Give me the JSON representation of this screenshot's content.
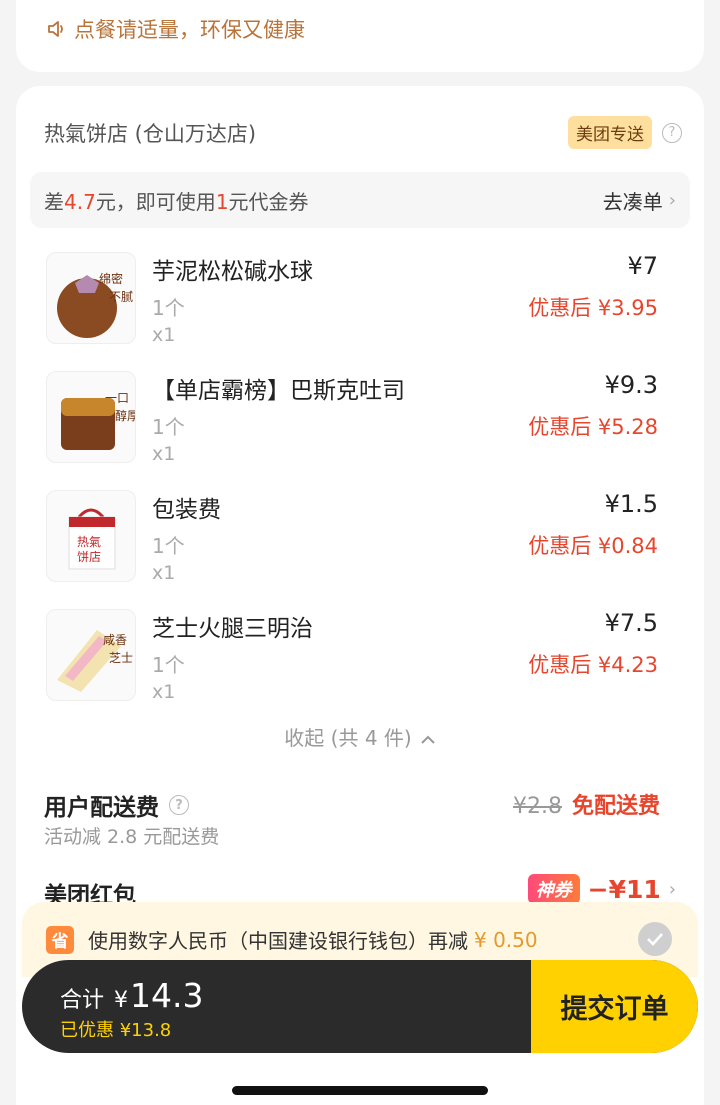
{
  "notice": {
    "text": "点餐请适量，环保又健康"
  },
  "store": {
    "name": "热氣饼店 (仓山万达店)",
    "delivery_badge": "美团专送",
    "help": "?"
  },
  "coupon_bar": {
    "prefix": "差",
    "amount": "4.7",
    "middle": "元，即可使用",
    "coupon_value": "1",
    "suffix": "元代金券",
    "action": "去凑单"
  },
  "items": [
    {
      "name": "芋泥松松碱水球",
      "qty": "1个",
      "count": "x1",
      "price": "¥7",
      "discount": "优惠后 ¥3.95"
    },
    {
      "name": "【单店霸榜】巴斯克吐司",
      "qty": "1个",
      "count": "x1",
      "price": "¥9.3",
      "discount": "优惠后 ¥5.28"
    },
    {
      "name": "包装费",
      "qty": "1个",
      "count": "x1",
      "price": "¥1.5",
      "discount": "优惠后 ¥0.84"
    },
    {
      "name": "芝士火腿三明治",
      "qty": "1个",
      "count": "x1",
      "price": "¥7.5",
      "discount": "优惠后 ¥4.23"
    }
  ],
  "collapse": {
    "label": "收起 (共 4 件)"
  },
  "delivery_fee": {
    "title": "用户配送费",
    "subtitle": "活动减 2.8 元配送费",
    "original": "¥2.8",
    "final": "免配送费"
  },
  "red_packet": {
    "title": "美团红包",
    "badge": "神券",
    "amount": "−¥11"
  },
  "payment": {
    "icon_char": "省",
    "text": "使用数字人民币（中国建设银行钱包）再减",
    "amount": "¥ 0.50"
  },
  "checkout": {
    "total_label": "合计",
    "currency": "¥",
    "total": "14.3",
    "saved": "已优惠 ¥13.8",
    "submit": "提交订单"
  },
  "colors": {
    "accent_red": "#e6462e",
    "brand_yellow": "#ffd100",
    "notice_brown": "#b8743a"
  }
}
